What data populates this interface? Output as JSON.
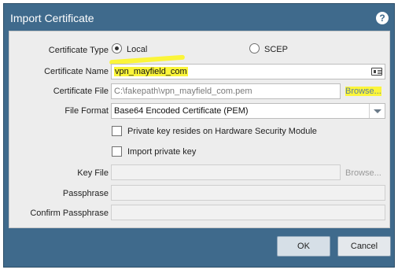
{
  "dialog": {
    "title": "Import Certificate",
    "help_icon": "help-icon"
  },
  "form": {
    "certificate_type": {
      "label": "Certificate Type",
      "options": [
        "Local",
        "SCEP"
      ],
      "selected": "Local"
    },
    "certificate_name": {
      "label": "Certificate Name",
      "value": "vpn_mayfield_com",
      "icon": "certificate-icon"
    },
    "certificate_file": {
      "label": "Certificate File",
      "value": "C:\\fakepath\\vpn_mayfield_com.pem",
      "browse_label": "Browse..."
    },
    "file_format": {
      "label": "File Format",
      "value": "Base64 Encoded Certificate (PEM)"
    },
    "hsm_checkbox": {
      "label": "Private key resides on Hardware Security Module",
      "checked": false
    },
    "import_private_key": {
      "label": "Import private key",
      "checked": false
    },
    "key_file": {
      "label": "Key File",
      "value": "",
      "browse_label": "Browse..."
    },
    "passphrase": {
      "label": "Passphrase",
      "value": ""
    },
    "confirm_passphrase": {
      "label": "Confirm Passphrase",
      "value": ""
    }
  },
  "buttons": {
    "ok": "OK",
    "cancel": "Cancel"
  },
  "colors": {
    "title_bar": "#3f6a8c",
    "highlight": "#fbf53a",
    "form_background": "#ededed"
  }
}
